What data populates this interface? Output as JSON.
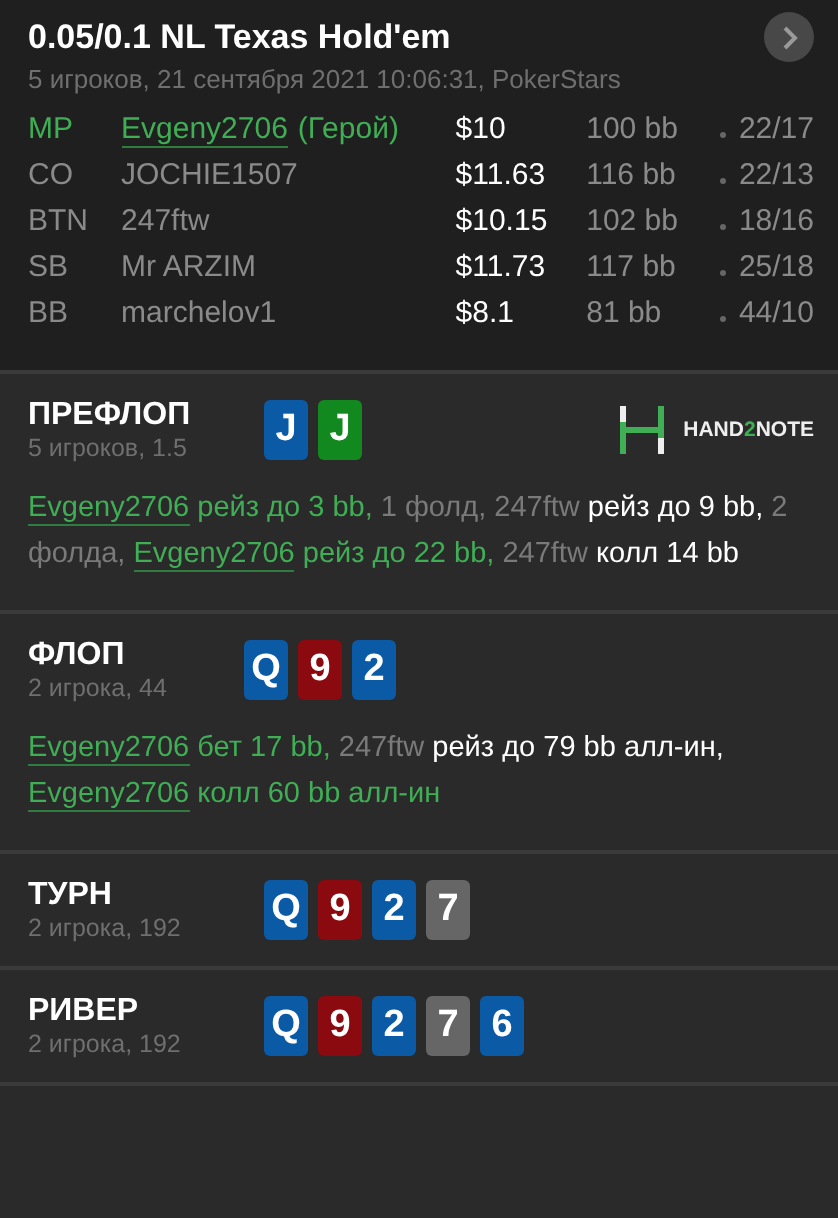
{
  "header": {
    "title": "0.05/0.1 NL Texas Hold'em",
    "subtitle": "5 игроков, 21 сентября 2021 10:06:31, PokerStars"
  },
  "players": [
    {
      "position": "MP",
      "name": "Evgeny2706",
      "hero": true,
      "hero_label": "(Герой)",
      "stack": "$10",
      "bb": "100 bb",
      "stats": "22/17"
    },
    {
      "position": "CO",
      "name": "JOCHIE1507",
      "hero": false,
      "stack": "$11.63",
      "bb": "116 bb",
      "stats": "22/13"
    },
    {
      "position": "BTN",
      "name": "247ftw",
      "hero": false,
      "stack": "$10.15",
      "bb": "102 bb",
      "stats": "18/16"
    },
    {
      "position": "SB",
      "name": "Mr ARZIM",
      "hero": false,
      "stack": "$11.73",
      "bb": "117 bb",
      "stats": "25/18"
    },
    {
      "position": "BB",
      "name": "marchelov1",
      "hero": false,
      "stack": "$8.1",
      "bb": "81 bb",
      "stats": "44/10"
    }
  ],
  "streets": [
    {
      "name": "ПРЕФЛОП",
      "info": "5 игроков, 1.5",
      "logo_text": [
        "HAND",
        "2",
        "NOTE"
      ],
      "cards": [
        {
          "rank": "J",
          "color": "#0b5aa6"
        },
        {
          "rank": "J",
          "color": "#11891f"
        }
      ],
      "actions": [
        {
          "kind": "hero-name",
          "text": "Evgeny2706"
        },
        {
          "kind": "hero-action",
          "text": "рейз до 3 bb,"
        },
        {
          "kind": "fold",
          "text": "1 фолд,"
        },
        {
          "kind": "name",
          "text": "247ftw"
        },
        {
          "kind": "action",
          "text": "рейз до 9 bb,"
        },
        {
          "kind": "fold",
          "text": "2 фолда,"
        },
        {
          "kind": "hero-name",
          "text": "Evgeny2706"
        },
        {
          "kind": "hero-action",
          "text": "рейз до 22 bb,"
        },
        {
          "kind": "name",
          "text": "247ftw"
        },
        {
          "kind": "action",
          "text": "колл 14 bb"
        }
      ]
    },
    {
      "name": "ФЛОП",
      "info": "2 игрока, 44",
      "cards": [
        {
          "rank": "Q",
          "color": "#0b5aa6"
        },
        {
          "rank": "9",
          "color": "#8a0a0f"
        },
        {
          "rank": "2",
          "color": "#0b5aa6"
        }
      ],
      "actions": [
        {
          "kind": "hero-name",
          "text": "Evgeny2706"
        },
        {
          "kind": "hero-action",
          "text": "бет 17 bb,"
        },
        {
          "kind": "name",
          "text": "247ftw"
        },
        {
          "kind": "action",
          "text": "рейз до 79 bb алл-ин,"
        },
        {
          "kind": "hero-name",
          "text": "Evgeny2706"
        },
        {
          "kind": "hero-action",
          "text": "колл 60 bb алл-ин"
        }
      ]
    },
    {
      "name": "ТУРН",
      "info": "2 игрока, 192",
      "cards": [
        {
          "rank": "Q",
          "color": "#0b5aa6"
        },
        {
          "rank": "9",
          "color": "#8a0a0f"
        },
        {
          "rank": "2",
          "color": "#0b5aa6"
        },
        {
          "rank": "7",
          "color": "#666666"
        }
      ]
    },
    {
      "name": "РИВЕР",
      "info": "2 игрока, 192",
      "cards": [
        {
          "rank": "Q",
          "color": "#0b5aa6"
        },
        {
          "rank": "9",
          "color": "#8a0a0f"
        },
        {
          "rank": "2",
          "color": "#0b5aa6"
        },
        {
          "rank": "7",
          "color": "#666666"
        },
        {
          "rank": "6",
          "color": "#0b5aa6"
        }
      ]
    }
  ]
}
